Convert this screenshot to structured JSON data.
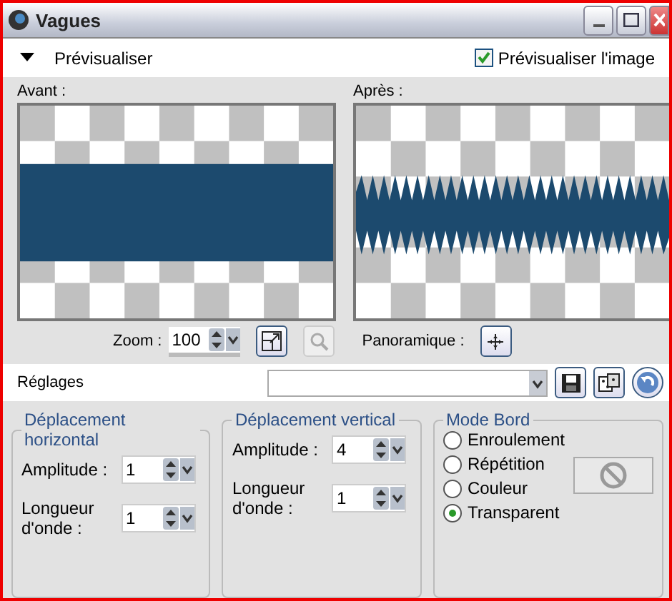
{
  "window": {
    "title": "Vagues"
  },
  "preview_bar": {
    "label": "Prévisualiser",
    "expanded": true,
    "checkbox": {
      "label": "Prévisualiser l'image",
      "checked": true
    }
  },
  "previews": [
    {
      "label": "Avant :",
      "kind": "flat"
    },
    {
      "label": "Après :",
      "kind": "wavy"
    }
  ],
  "zoom": {
    "label": "Zoom :",
    "value": "100"
  },
  "pan": {
    "label": "Panoramique :"
  },
  "presets": {
    "label": "Réglages"
  },
  "groups": [
    {
      "title": "Déplacement horizontal",
      "fields": [
        {
          "label": "Amplitude :",
          "value": "1"
        },
        {
          "label": "Longueur d'onde :",
          "value": "1"
        }
      ]
    },
    {
      "title": "Déplacement vertical",
      "fields": [
        {
          "label": "Amplitude :",
          "value": "4"
        },
        {
          "label": "Longueur d'onde :",
          "value": "1"
        }
      ]
    }
  ],
  "edge_mode": {
    "title": "Mode Bord",
    "options": [
      {
        "label": "Enroulement",
        "selected": false
      },
      {
        "label": "Répétition",
        "selected": false
      },
      {
        "label": "Couleur",
        "selected": false
      },
      {
        "label": "Transparent",
        "selected": true
      }
    ]
  }
}
